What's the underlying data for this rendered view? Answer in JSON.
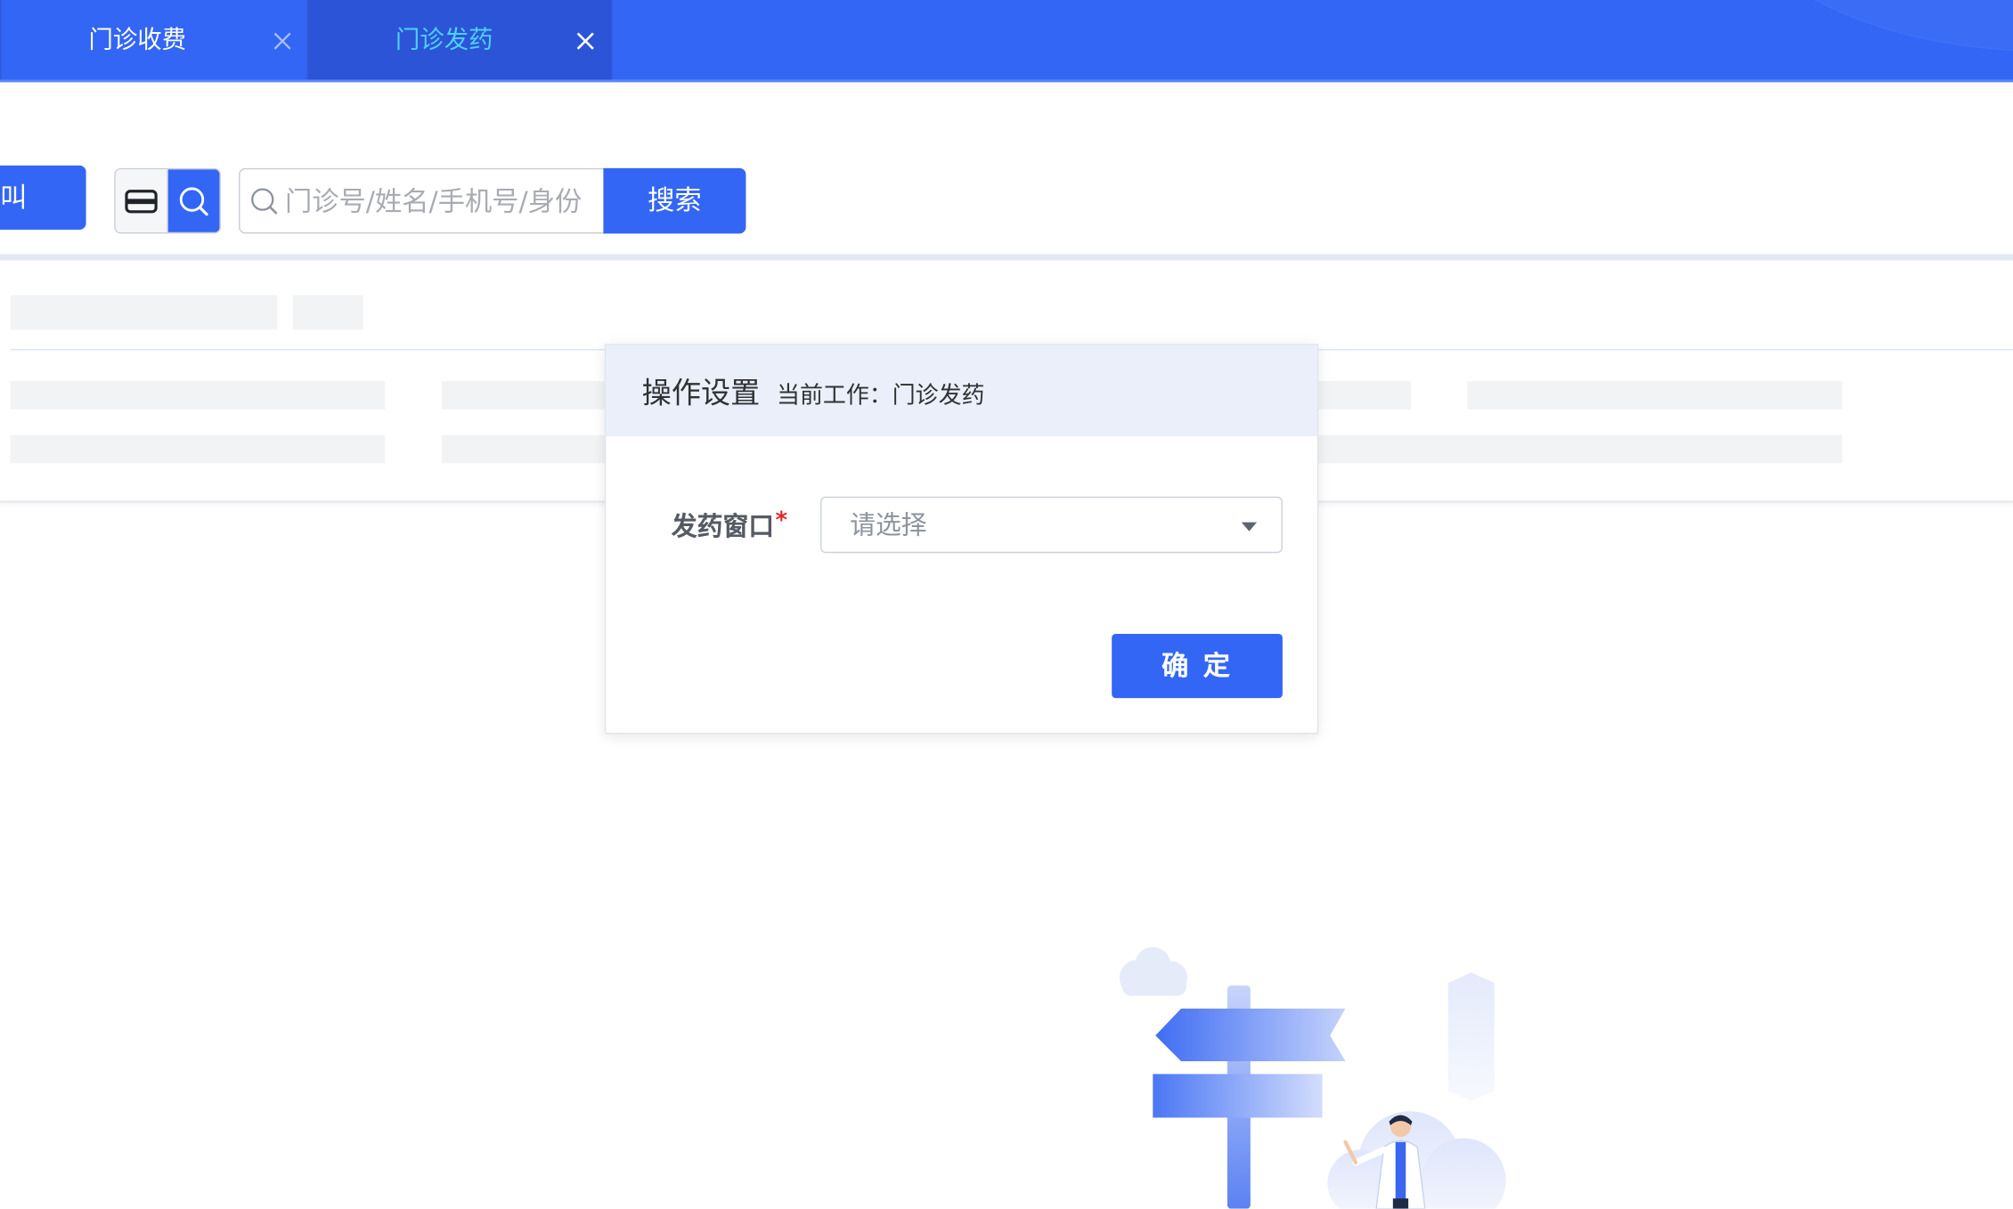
{
  "tabs": [
    {
      "label": "门诊收费",
      "active": false
    },
    {
      "label": "门诊发药",
      "active": true
    }
  ],
  "toolbar": {
    "call_label": "叫",
    "search_placeholder": "门诊号/姓名/手机号/身份",
    "search_button": "搜索"
  },
  "modal": {
    "title": "操作设置",
    "subtitle": "当前工作：门诊发药",
    "field_label": "发药窗口",
    "required_mark": "*",
    "select_placeholder": "请选择",
    "confirm_button": "确 定"
  },
  "colors": {
    "primary": "#3366f5",
    "active_tab_bg": "#2b55d6",
    "active_tab_text": "#4fd0ff",
    "required": "#e02828"
  }
}
